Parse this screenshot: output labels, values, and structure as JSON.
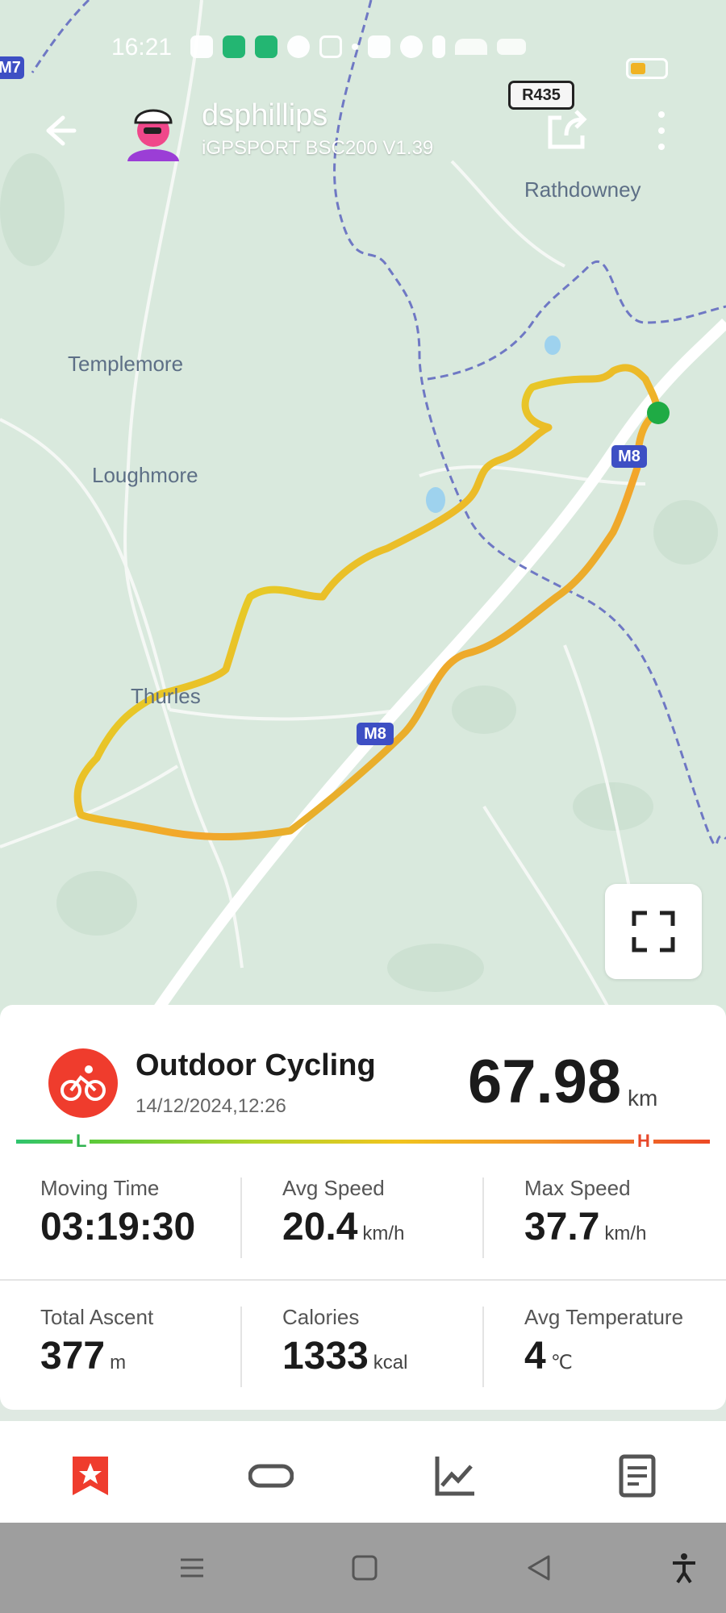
{
  "status_bar": {
    "time": "16:21",
    "icons": [
      "face-icon",
      "spotify-icon",
      "battery-saver-icon",
      "cloud-icon",
      "instagram-icon",
      "dot-icon",
      "nfc-icon",
      "alarm-icon",
      "bluetooth-icon",
      "wifi-icon",
      "signal-icon",
      "battery-icon"
    ],
    "battery_level": 0.45
  },
  "header": {
    "username": "dsphillips",
    "device": "iGPSPORT BSC200  V1.39"
  },
  "map": {
    "places": [
      "Rathdowney",
      "Templemore",
      "Loughmore",
      "Thurles"
    ],
    "road_badges": [
      "R435",
      "M8",
      "M7",
      "M8"
    ]
  },
  "activity": {
    "type": "Outdoor Cycling",
    "datetime": "14/12/2024,12:26",
    "distance": "67.98",
    "distance_unit": "km",
    "legend_low": "L",
    "legend_high": "H"
  },
  "stats": [
    {
      "label": "Moving Time",
      "value": "03:19:30",
      "unit": ""
    },
    {
      "label": "Avg Speed",
      "value": "20.4",
      "unit": "km/h"
    },
    {
      "label": "Max Speed",
      "value": "37.7",
      "unit": "km/h"
    },
    {
      "label": "Total Ascent",
      "value": "377",
      "unit": "m"
    },
    {
      "label": "Calories",
      "value": "1333",
      "unit": "kcal"
    },
    {
      "label": "Avg Temperature",
      "value": "4",
      "unit": "℃"
    }
  ],
  "tabs": [
    "summary-icon",
    "laps-icon",
    "chart-icon",
    "details-icon"
  ],
  "nav": [
    "menu-icon",
    "home-icon",
    "back-icon",
    "accessibility-icon"
  ],
  "colors": {
    "accent": "#ef3c2d",
    "route_start": "#1fab45"
  }
}
